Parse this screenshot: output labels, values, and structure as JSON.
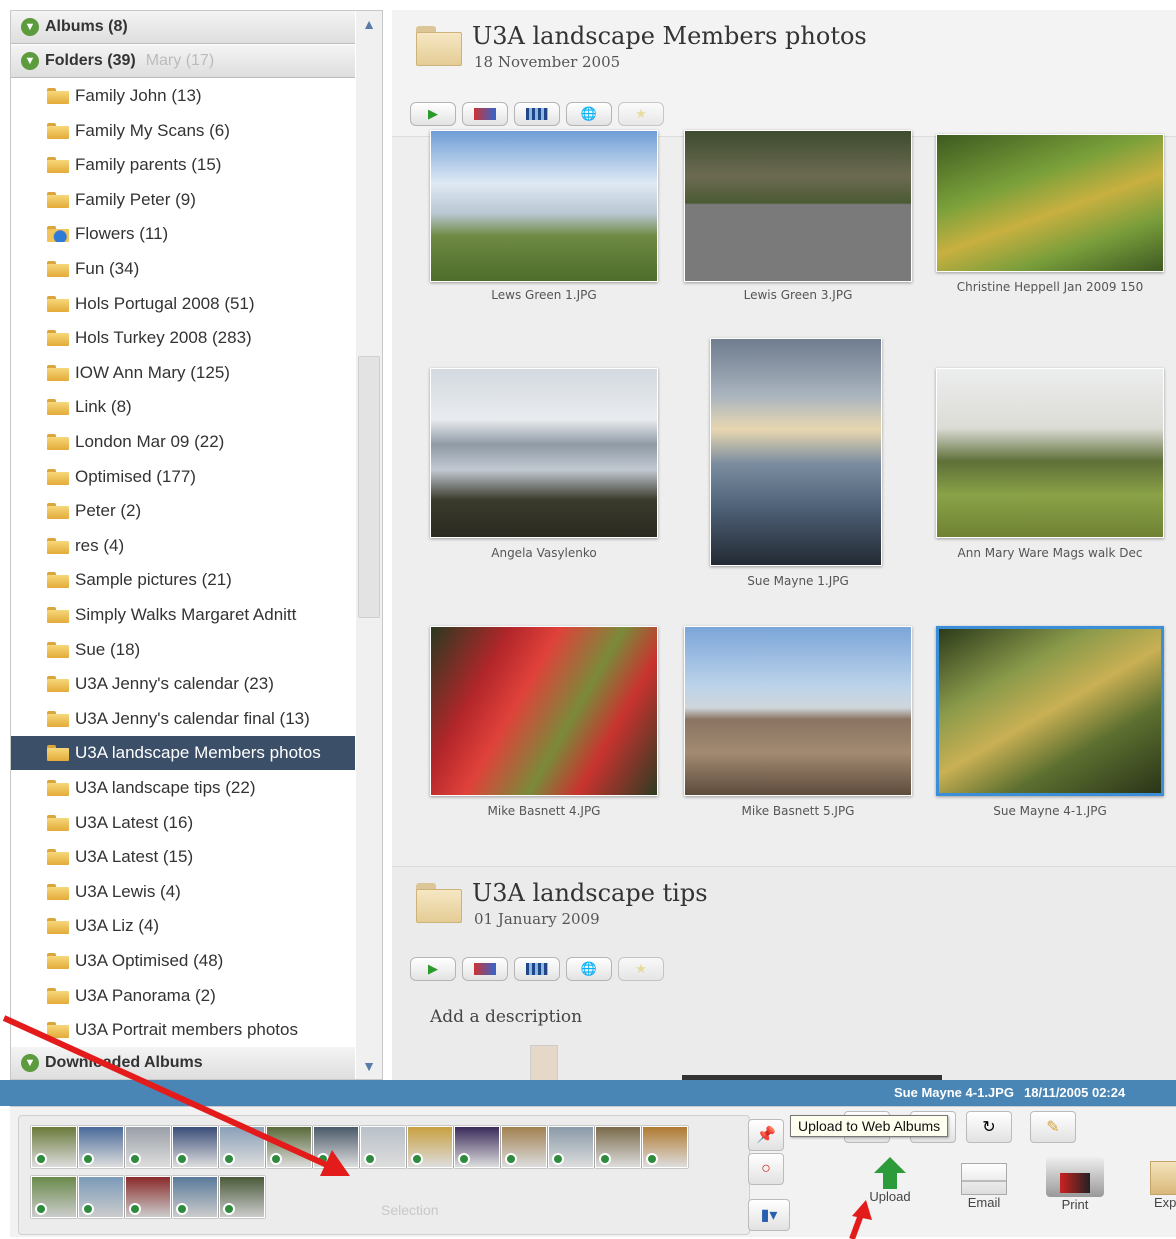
{
  "sidebar": {
    "albums_header": "Albums (8)",
    "folders_header": "Folders (39)",
    "folders_ghost": "Mary (17)",
    "folders": [
      "Family John (13)",
      "Family My Scans (6)",
      "Family parents (15)",
      "Family Peter (9)",
      "Flowers (11)",
      "Fun (34)",
      "Hols Portugal 2008 (51)",
      "Hols Turkey 2008 (283)",
      "IOW Ann Mary (125)",
      "Link (8)",
      "London Mar 09 (22)",
      "Optimised (177)",
      "Peter (2)",
      "res (4)",
      "Sample pictures (21)",
      "Simply Walks Margaret Adnitt",
      "Sue (18)",
      "U3A Jenny's calendar (23)",
      "U3A Jenny's calendar final (13)",
      "U3A landscape Members photos",
      "U3A landscape tips (22)",
      "U3A Latest (16)",
      "U3A Latest (15)",
      "U3A Lewis (4)",
      "U3A Liz (4)",
      "U3A Optimised (48)",
      "U3A Panorama (2)",
      "U3A Portrait members photos"
    ],
    "selected_index": 19,
    "downloaded_header": "Downloaded Albums"
  },
  "album1": {
    "title": "U3A landscape Members photos",
    "date": "18 November 2005",
    "photos": [
      "Lews Green 1.JPG",
      "Lewis Green 3.JPG",
      "Christine Heppell Jan 2009 150",
      "Angela Vasylenko",
      "Sue Mayne 1.JPG",
      "Ann Mary Ware Mags walk Dec",
      "Mike Basnett 4.JPG",
      "Mike Basnett 5.JPG",
      "Sue Mayne 4-1.JPG"
    ]
  },
  "album2": {
    "title": "U3A landscape tips",
    "date": "01 January 2009",
    "description_placeholder": "Add a description"
  },
  "status": {
    "filename": "Sue Mayne 4-1.JPG",
    "datetime": "18/11/2005 02:24"
  },
  "tray": {
    "selection_label": "Selection",
    "tooltip": "Upload to Web Albums",
    "actions": [
      "Upload",
      "Email",
      "Print",
      "Expo"
    ]
  },
  "colors": {
    "status_bar": "#4a86b5",
    "selected_row": "#3b4f68",
    "annotation_arrow": "#e31b1b"
  }
}
